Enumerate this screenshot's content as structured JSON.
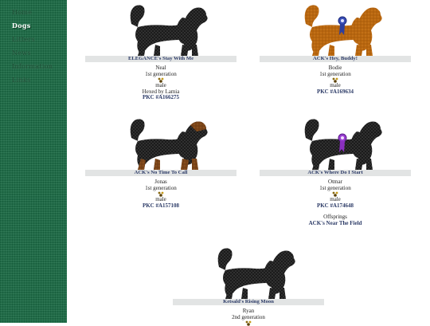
{
  "nav": {
    "items": [
      {
        "label": "Home",
        "active": false
      },
      {
        "label": "Dogs",
        "active": true
      },
      {
        "label": "Litters",
        "active": false
      },
      {
        "label": "News",
        "active": false
      },
      {
        "label": "Information",
        "active": false
      },
      {
        "label": "Links",
        "active": false
      }
    ]
  },
  "dogs": [
    {
      "title": "ELEGANCE's Stay With Me",
      "call_name": "Neal",
      "generation": "1st generation",
      "sex": "male",
      "note": "Hexed by Lamia",
      "reg": "PKC #A166275",
      "coat": "black",
      "ribbon": "none"
    },
    {
      "title": "ACK's Hey, Buddy!",
      "call_name": "Bodie",
      "generation": "1st generation",
      "sex": "male",
      "reg": "PKC #A169634",
      "coat": "red",
      "ribbon": "blue"
    },
    {
      "title": "ACK's No Time To Call",
      "call_name": "Jonas",
      "generation": "1st generation",
      "sex": "male",
      "reg": "PKC #A157108",
      "coat": "black-tan",
      "ribbon": "none"
    },
    {
      "title": "ACK's Where Do I Start",
      "call_name": "Otmar",
      "generation": "1st generation",
      "sex": "male",
      "reg": "PKC #A174648",
      "coat": "black",
      "ribbon": "purple",
      "offspring_label": "Offsprings",
      "offspring": "ACK's Near The Field"
    },
    {
      "title": "Ketsald's Rising Moon",
      "call_name": "Ryan",
      "generation": "2nd generation",
      "coat": "black",
      "ribbon": "none"
    }
  ],
  "colors": {
    "sidebar": "#1b6b45",
    "name_bar": "#e2e4e4",
    "link": "#2b3a66"
  }
}
